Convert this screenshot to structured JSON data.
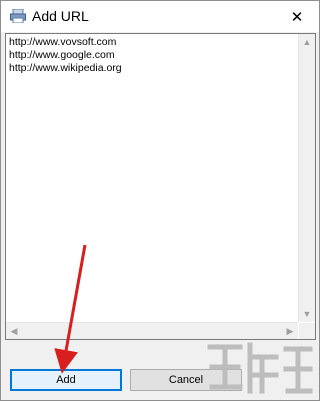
{
  "window": {
    "title": "Add URL",
    "close_glyph": "✕"
  },
  "url_box": {
    "lines": [
      "http://www.vovsoft.com",
      "http://www.google.com",
      "http://www.wikipedia.org"
    ]
  },
  "buttons": {
    "add_label": "Add",
    "cancel_label": "Cancel"
  },
  "scrollbar": {
    "up_glyph": "▲",
    "down_glyph": "▼",
    "left_glyph": "◀",
    "right_glyph": "▶"
  },
  "colors": {
    "focus_border": "#0078d7",
    "annotation_arrow": "#d81e1e"
  },
  "icons": {
    "app": "printer-like-window-icon",
    "close": "close-icon"
  }
}
